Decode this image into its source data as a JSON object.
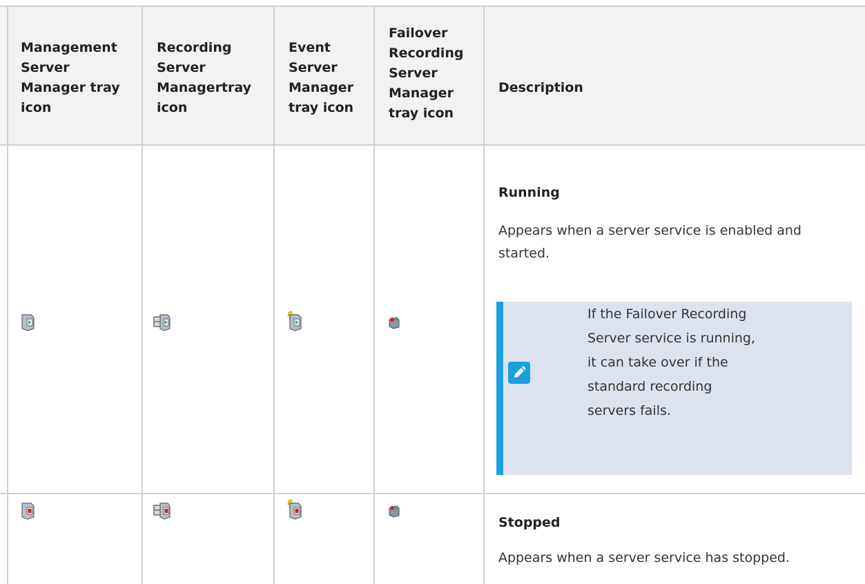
{
  "table": {
    "headers": {
      "col1": "Management\nServer\nManager tray\nicon",
      "col2": "Recording\nServer\nManagertray\nicon",
      "col3": "Event\nServer\nManager\ntray icon",
      "col4": "Failover\nRecording\nServer\nManager\ntray icon",
      "col5": "Description"
    },
    "rows": [
      {
        "status": "Running",
        "description": "Appears when a server service is enabled and started.",
        "note": "If the Failover Recording Server service is running, it can take over if the standard recording servers fails.",
        "note_icon": "pencil-icon",
        "icons": [
          "management-server-running-icon",
          "recording-server-running-icon",
          "event-server-running-icon",
          "failover-server-running-icon"
        ],
        "indicator_color": "#2db34a"
      },
      {
        "status": "Stopped",
        "description": "Appears when a server service has stopped.",
        "icons": [
          "management-server-stopped-icon",
          "recording-server-stopped-icon",
          "event-server-stopped-icon",
          "failover-server-stopped-icon"
        ],
        "indicator_color": "#d62020"
      }
    ]
  },
  "colors": {
    "header_bg": "#f2f2f2",
    "grid": "#cfcfcf",
    "note_bg": "#dce3ee",
    "note_accent": "#1aa0dc"
  }
}
